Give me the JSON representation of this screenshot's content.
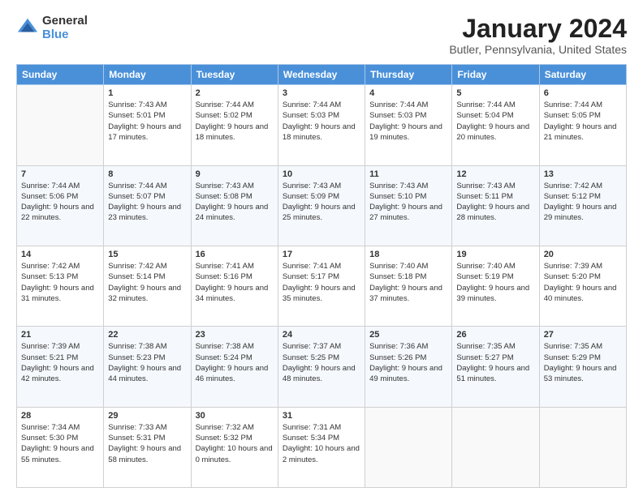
{
  "logo": {
    "general": "General",
    "blue": "Blue"
  },
  "title": "January 2024",
  "location": "Butler, Pennsylvania, United States",
  "weekdays": [
    "Sunday",
    "Monday",
    "Tuesday",
    "Wednesday",
    "Thursday",
    "Friday",
    "Saturday"
  ],
  "weeks": [
    [
      {
        "day": "",
        "empty": true
      },
      {
        "day": "1",
        "sunrise": "Sunrise: 7:43 AM",
        "sunset": "Sunset: 5:01 PM",
        "daylight": "Daylight: 9 hours and 17 minutes."
      },
      {
        "day": "2",
        "sunrise": "Sunrise: 7:44 AM",
        "sunset": "Sunset: 5:02 PM",
        "daylight": "Daylight: 9 hours and 18 minutes."
      },
      {
        "day": "3",
        "sunrise": "Sunrise: 7:44 AM",
        "sunset": "Sunset: 5:03 PM",
        "daylight": "Daylight: 9 hours and 18 minutes."
      },
      {
        "day": "4",
        "sunrise": "Sunrise: 7:44 AM",
        "sunset": "Sunset: 5:03 PM",
        "daylight": "Daylight: 9 hours and 19 minutes."
      },
      {
        "day": "5",
        "sunrise": "Sunrise: 7:44 AM",
        "sunset": "Sunset: 5:04 PM",
        "daylight": "Daylight: 9 hours and 20 minutes."
      },
      {
        "day": "6",
        "sunrise": "Sunrise: 7:44 AM",
        "sunset": "Sunset: 5:05 PM",
        "daylight": "Daylight: 9 hours and 21 minutes."
      }
    ],
    [
      {
        "day": "7",
        "sunrise": "Sunrise: 7:44 AM",
        "sunset": "Sunset: 5:06 PM",
        "daylight": "Daylight: 9 hours and 22 minutes."
      },
      {
        "day": "8",
        "sunrise": "Sunrise: 7:44 AM",
        "sunset": "Sunset: 5:07 PM",
        "daylight": "Daylight: 9 hours and 23 minutes."
      },
      {
        "day": "9",
        "sunrise": "Sunrise: 7:43 AM",
        "sunset": "Sunset: 5:08 PM",
        "daylight": "Daylight: 9 hours and 24 minutes."
      },
      {
        "day": "10",
        "sunrise": "Sunrise: 7:43 AM",
        "sunset": "Sunset: 5:09 PM",
        "daylight": "Daylight: 9 hours and 25 minutes."
      },
      {
        "day": "11",
        "sunrise": "Sunrise: 7:43 AM",
        "sunset": "Sunset: 5:10 PM",
        "daylight": "Daylight: 9 hours and 27 minutes."
      },
      {
        "day": "12",
        "sunrise": "Sunrise: 7:43 AM",
        "sunset": "Sunset: 5:11 PM",
        "daylight": "Daylight: 9 hours and 28 minutes."
      },
      {
        "day": "13",
        "sunrise": "Sunrise: 7:42 AM",
        "sunset": "Sunset: 5:12 PM",
        "daylight": "Daylight: 9 hours and 29 minutes."
      }
    ],
    [
      {
        "day": "14",
        "sunrise": "Sunrise: 7:42 AM",
        "sunset": "Sunset: 5:13 PM",
        "daylight": "Daylight: 9 hours and 31 minutes."
      },
      {
        "day": "15",
        "sunrise": "Sunrise: 7:42 AM",
        "sunset": "Sunset: 5:14 PM",
        "daylight": "Daylight: 9 hours and 32 minutes."
      },
      {
        "day": "16",
        "sunrise": "Sunrise: 7:41 AM",
        "sunset": "Sunset: 5:16 PM",
        "daylight": "Daylight: 9 hours and 34 minutes."
      },
      {
        "day": "17",
        "sunrise": "Sunrise: 7:41 AM",
        "sunset": "Sunset: 5:17 PM",
        "daylight": "Daylight: 9 hours and 35 minutes."
      },
      {
        "day": "18",
        "sunrise": "Sunrise: 7:40 AM",
        "sunset": "Sunset: 5:18 PM",
        "daylight": "Daylight: 9 hours and 37 minutes."
      },
      {
        "day": "19",
        "sunrise": "Sunrise: 7:40 AM",
        "sunset": "Sunset: 5:19 PM",
        "daylight": "Daylight: 9 hours and 39 minutes."
      },
      {
        "day": "20",
        "sunrise": "Sunrise: 7:39 AM",
        "sunset": "Sunset: 5:20 PM",
        "daylight": "Daylight: 9 hours and 40 minutes."
      }
    ],
    [
      {
        "day": "21",
        "sunrise": "Sunrise: 7:39 AM",
        "sunset": "Sunset: 5:21 PM",
        "daylight": "Daylight: 9 hours and 42 minutes."
      },
      {
        "day": "22",
        "sunrise": "Sunrise: 7:38 AM",
        "sunset": "Sunset: 5:23 PM",
        "daylight": "Daylight: 9 hours and 44 minutes."
      },
      {
        "day": "23",
        "sunrise": "Sunrise: 7:38 AM",
        "sunset": "Sunset: 5:24 PM",
        "daylight": "Daylight: 9 hours and 46 minutes."
      },
      {
        "day": "24",
        "sunrise": "Sunrise: 7:37 AM",
        "sunset": "Sunset: 5:25 PM",
        "daylight": "Daylight: 9 hours and 48 minutes."
      },
      {
        "day": "25",
        "sunrise": "Sunrise: 7:36 AM",
        "sunset": "Sunset: 5:26 PM",
        "daylight": "Daylight: 9 hours and 49 minutes."
      },
      {
        "day": "26",
        "sunrise": "Sunrise: 7:35 AM",
        "sunset": "Sunset: 5:27 PM",
        "daylight": "Daylight: 9 hours and 51 minutes."
      },
      {
        "day": "27",
        "sunrise": "Sunrise: 7:35 AM",
        "sunset": "Sunset: 5:29 PM",
        "daylight": "Daylight: 9 hours and 53 minutes."
      }
    ],
    [
      {
        "day": "28",
        "sunrise": "Sunrise: 7:34 AM",
        "sunset": "Sunset: 5:30 PM",
        "daylight": "Daylight: 9 hours and 55 minutes."
      },
      {
        "day": "29",
        "sunrise": "Sunrise: 7:33 AM",
        "sunset": "Sunset: 5:31 PM",
        "daylight": "Daylight: 9 hours and 58 minutes."
      },
      {
        "day": "30",
        "sunrise": "Sunrise: 7:32 AM",
        "sunset": "Sunset: 5:32 PM",
        "daylight": "Daylight: 10 hours and 0 minutes."
      },
      {
        "day": "31",
        "sunrise": "Sunrise: 7:31 AM",
        "sunset": "Sunset: 5:34 PM",
        "daylight": "Daylight: 10 hours and 2 minutes."
      },
      {
        "day": "",
        "empty": true
      },
      {
        "day": "",
        "empty": true
      },
      {
        "day": "",
        "empty": true
      }
    ]
  ]
}
